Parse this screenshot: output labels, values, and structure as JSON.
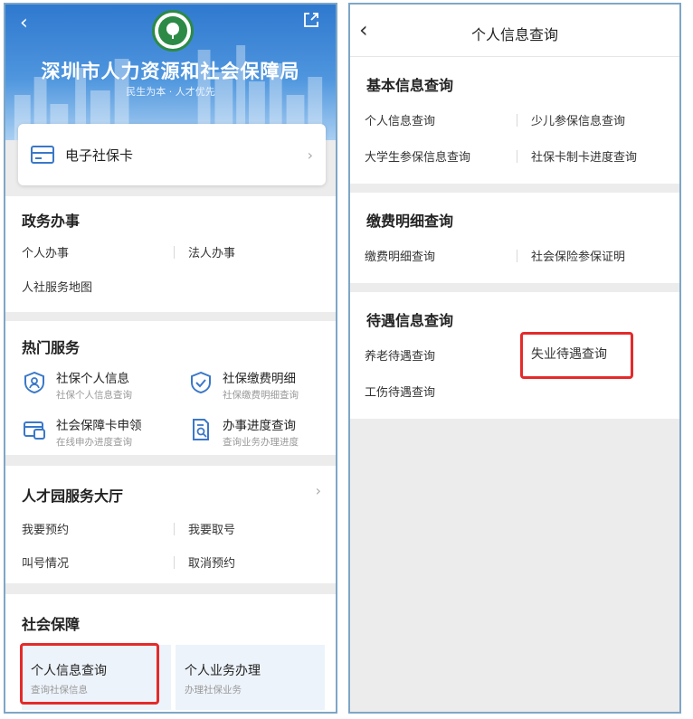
{
  "left": {
    "header": {
      "title": "深圳市人力资源和社会保障局",
      "slogan": "民生为本 · 人才优先"
    },
    "ecard": {
      "label": "电子社保卡"
    },
    "government": {
      "title": "政务办事",
      "items": [
        "个人办事",
        "法人办事",
        "人社服务地图"
      ]
    },
    "hot": {
      "title": "热门服务",
      "services": [
        {
          "name": "社保个人信息",
          "sub": "社保个人信息查询",
          "icon": "shield-person-icon"
        },
        {
          "name": "社保缴费明细",
          "sub": "社保缴费明细查询",
          "icon": "shield-check-icon"
        },
        {
          "name": "社会保障卡申领",
          "sub": "在线申办进度查询",
          "icon": "card-apply-icon"
        },
        {
          "name": "办事进度查询",
          "sub": "查询业务办理进度",
          "icon": "document-search-icon"
        }
      ]
    },
    "talent": {
      "title": "人才园服务大厅",
      "items": [
        "我要预约",
        "我要取号",
        "叫号情况",
        "取消预约"
      ]
    },
    "social": {
      "title": "社会保障",
      "tiles": [
        {
          "name": "个人信息查询",
          "sub": "查询社保信息"
        },
        {
          "name": "个人业务办理",
          "sub": "办理社保业务"
        }
      ]
    }
  },
  "right": {
    "title": "个人信息查询",
    "sections": [
      {
        "title": "基本信息查询",
        "items": [
          "个人信息查询",
          "少儿参保信息查询",
          "大学生参保信息查询",
          "社保卡制卡进度查询"
        ]
      },
      {
        "title": "缴费明细查询",
        "items": [
          "缴费明细查询",
          "社会保险参保证明"
        ]
      },
      {
        "title": "待遇信息查询",
        "items": [
          "养老待遇查询",
          "失业待遇查询",
          "工伤待遇查询"
        ]
      }
    ]
  },
  "colors": {
    "accent": "#3a78c9",
    "highlight": "#e52a2a",
    "tile_bg": "#edf3fb"
  }
}
